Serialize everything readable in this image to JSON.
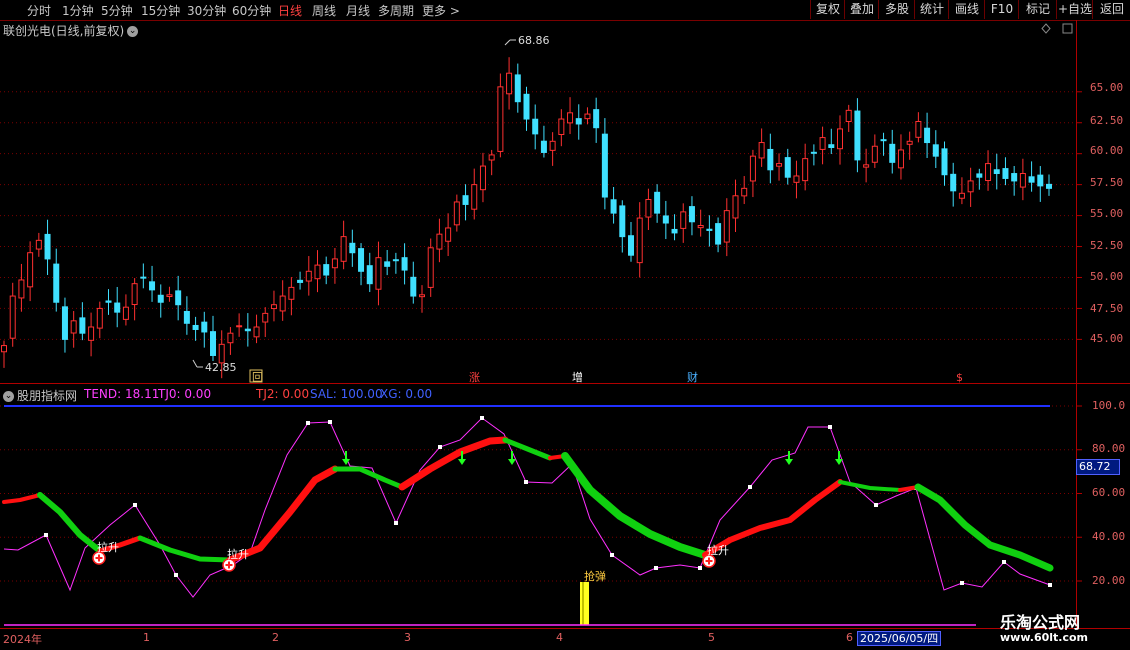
{
  "toolbar": {
    "periods": [
      {
        "label": "分时",
        "active": false
      },
      {
        "label": "1分钟",
        "active": false
      },
      {
        "label": "5分钟",
        "active": false
      },
      {
        "label": "15分钟",
        "active": false
      },
      {
        "label": "30分钟",
        "active": false
      },
      {
        "label": "60分钟",
        "active": false
      },
      {
        "label": "日线",
        "active": true
      },
      {
        "label": "周线",
        "active": false
      },
      {
        "label": "月线",
        "active": false
      },
      {
        "label": "多周期",
        "active": false
      },
      {
        "label": "更多 >",
        "active": false
      }
    ],
    "buttons": [
      "复权",
      "叠加",
      "多股",
      "统计",
      "画线",
      "F10",
      "标记",
      "+自选",
      "返回"
    ]
  },
  "main_chart": {
    "title": "联创光电(日线,前复权)",
    "high_label": "68.86",
    "low_label": "42.85",
    "price_ticks": [
      "65.00",
      "62.50",
      "60.00",
      "57.50",
      "55.00",
      "52.50",
      "50.00",
      "47.50",
      "45.00"
    ],
    "markers": [
      {
        "text": "回",
        "color": "#e0c060"
      },
      {
        "text": "涨",
        "color": "#ff4040"
      },
      {
        "text": "增",
        "color": "#ffffff"
      },
      {
        "text": "财",
        "color": "#4ab0ff"
      },
      {
        "text": "$",
        "color": "#ff4040"
      }
    ]
  },
  "indicator": {
    "title": "股朋指标网",
    "values": [
      {
        "text": "TEND: 18.11",
        "color": "#ff40ff"
      },
      {
        "text": "TJ0: 0.00",
        "color": "#ff40ff"
      },
      {
        "text": "TJ2: 0.00",
        "color": "#ff4040"
      },
      {
        "text": "SAL: 100.00",
        "color": "#4060ff"
      },
      {
        "text": "XG: 0.00",
        "color": "#4060ff"
      }
    ],
    "ticks": [
      "100.0",
      "80.00",
      "60.00",
      "40.00",
      "20.00"
    ],
    "current_value": "68.72",
    "signal_lift": "拉升",
    "signal_rebound": "抢弹"
  },
  "time_axis": {
    "labels": [
      "2024年",
      "1",
      "2",
      "3",
      "4",
      "5",
      "6"
    ],
    "cursor_date": "2025/06/05/四"
  },
  "watermark": {
    "site_name": "乐淘公式网",
    "url": "www.60lt.com"
  },
  "chart_data": {
    "type": "candlestick",
    "price_axis": {
      "min": 42.85,
      "max": 68.86,
      "ticks": [
        45,
        47.5,
        50,
        52.5,
        55,
        57.5,
        60,
        62.5,
        65
      ]
    },
    "closes": [
      44.5,
      48.5,
      49.8,
      52.0,
      53.0,
      51.5,
      48.0,
      45.0,
      46.5,
      45.5,
      46.0,
      47.5,
      48.0,
      47.2,
      47.6,
      49.5,
      50.0,
      49.0,
      48.0,
      48.6,
      47.8,
      46.3,
      45.8,
      45.6,
      43.7,
      44.6,
      45.5,
      46.1,
      45.7,
      46.0,
      47.1,
      47.8,
      48.5,
      49.2,
      49.6,
      50.5,
      51.0,
      50.2,
      51.5,
      53.3,
      52.0,
      50.5,
      49.5,
      51.6,
      50.9,
      51.4,
      50.6,
      48.5,
      48.6,
      52.4,
      53.5,
      54.0,
      56.1,
      55.9,
      57.5,
      59.0,
      59.9,
      65.4,
      66.5,
      64.2,
      62.8,
      61.6,
      60.1,
      61.0,
      62.8,
      63.3,
      62.4,
      63.2,
      62.1,
      56.5,
      55.2,
      53.3,
      51.8,
      54.8,
      56.3,
      55.2,
      54.4,
      53.6,
      55.3,
      54.5,
      54.2,
      53.8,
      52.7,
      55.4,
      56.6,
      57.2,
      59.8,
      60.9,
      58.7,
      59.2,
      58.1,
      58.2,
      59.6,
      60.1,
      61.3,
      60.5,
      62.0,
      63.5,
      59.5,
      59.1,
      60.6,
      61.1,
      59.3,
      60.3,
      61.0,
      62.6,
      60.9,
      59.8,
      58.3,
      57.0,
      56.8,
      57.8,
      58.1,
      59.2,
      58.4,
      58.0,
      57.8,
      58.4,
      57.7,
      57.4,
      57.2
    ]
  }
}
